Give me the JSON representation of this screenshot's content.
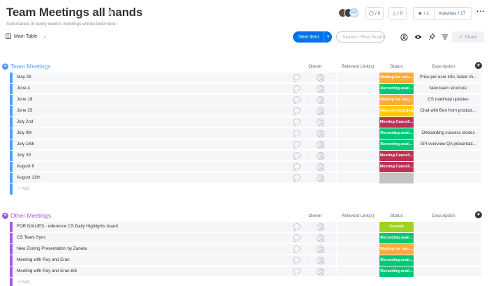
{
  "board": {
    "title": "Team Meetings all hands",
    "subtitle": "Summaries of every week's meetings will be held here!",
    "avatar_initials": "EA",
    "updates_count": "/ 0",
    "likes_count": "/ 0",
    "members_count": "/ 1",
    "activities_label": "Activities",
    "activities_count": "/ 17"
  },
  "toolbar": {
    "view_label": "Main Table",
    "new_item_label": "New Item",
    "search_placeholder": "Search / Filter Board",
    "share_label": "Share"
  },
  "columns": {
    "owner": "Owner",
    "links": "Relevant Link(s)",
    "status": "Status",
    "description": "Description"
  },
  "colors": {
    "done": "#00c875",
    "waiting": "#fdab3d",
    "cancelled": "#bb3354",
    "not_recorded": "#ffcb00",
    "empty": "#c4c4c4",
    "group1": "#579bfc",
    "group2": "#a25ddc",
    "accent": "#0073ea"
  },
  "groups": [
    {
      "title": "Team Meetings",
      "color": "#579bfc",
      "add_label": "+ Add",
      "rows": [
        {
          "name": "May 28",
          "status": "Waiting for reco...",
          "status_color": "#fdab3d",
          "desc": "Price per user info, failed ch..."
        },
        {
          "name": "June 4",
          "status": "Recording avail...",
          "status_color": "#00c875",
          "desc": "New team structure"
        },
        {
          "name": "June 18",
          "status": "Waiting for reco...",
          "status_color": "#fdab3d",
          "desc": "CS roadmap updates"
        },
        {
          "name": "June 25",
          "status": "Was not recorded",
          "status_color": "#ffcb00",
          "desc": "Chat with Ben from product..."
        },
        {
          "name": "July 2nd",
          "status": "Meeting Cancell...",
          "status_color": "#bb3354",
          "desc": ""
        },
        {
          "name": "July 9th",
          "status": "Recording avail...",
          "status_color": "#00c875",
          "desc": "Onboarding success stories"
        },
        {
          "name": "July 16th",
          "status": "Recording avail...",
          "status_color": "#00c875",
          "desc": "API overview QA presentati..."
        },
        {
          "name": "July 29",
          "status": "Meeting Cancell...",
          "status_color": "#bb3354",
          "desc": ""
        },
        {
          "name": "August 6",
          "status": "Meeting Cancell...",
          "status_color": "#bb3354",
          "desc": ""
        },
        {
          "name": "August 13th",
          "status": "",
          "status_color": "#c4c4c4",
          "desc": ""
        }
      ]
    },
    {
      "title": "Other Meetings",
      "color": "#a25ddc",
      "add_label": "+ Add",
      "rows": [
        {
          "name": "FOR DAILIES - reference CS Daily Highlights board",
          "status": "Current",
          "status_color": "#9cd326",
          "desc": ""
        },
        {
          "name": "CS Team Sync",
          "status": "Recording avail...",
          "status_color": "#00c875",
          "desc": ""
        },
        {
          "name": "New Zoning Presentation by Zaneta",
          "status": "Waiting for reco...",
          "status_color": "#fdab3d",
          "desc": ""
        },
        {
          "name": "Meeting with Roy and Eran",
          "status": "Recording avail...",
          "status_color": "#00c875",
          "desc": ""
        },
        {
          "name": "Meeting with Roy and Eran 8/6",
          "status": "Recording avail...",
          "status_color": "#00c875",
          "desc": ""
        }
      ]
    }
  ]
}
